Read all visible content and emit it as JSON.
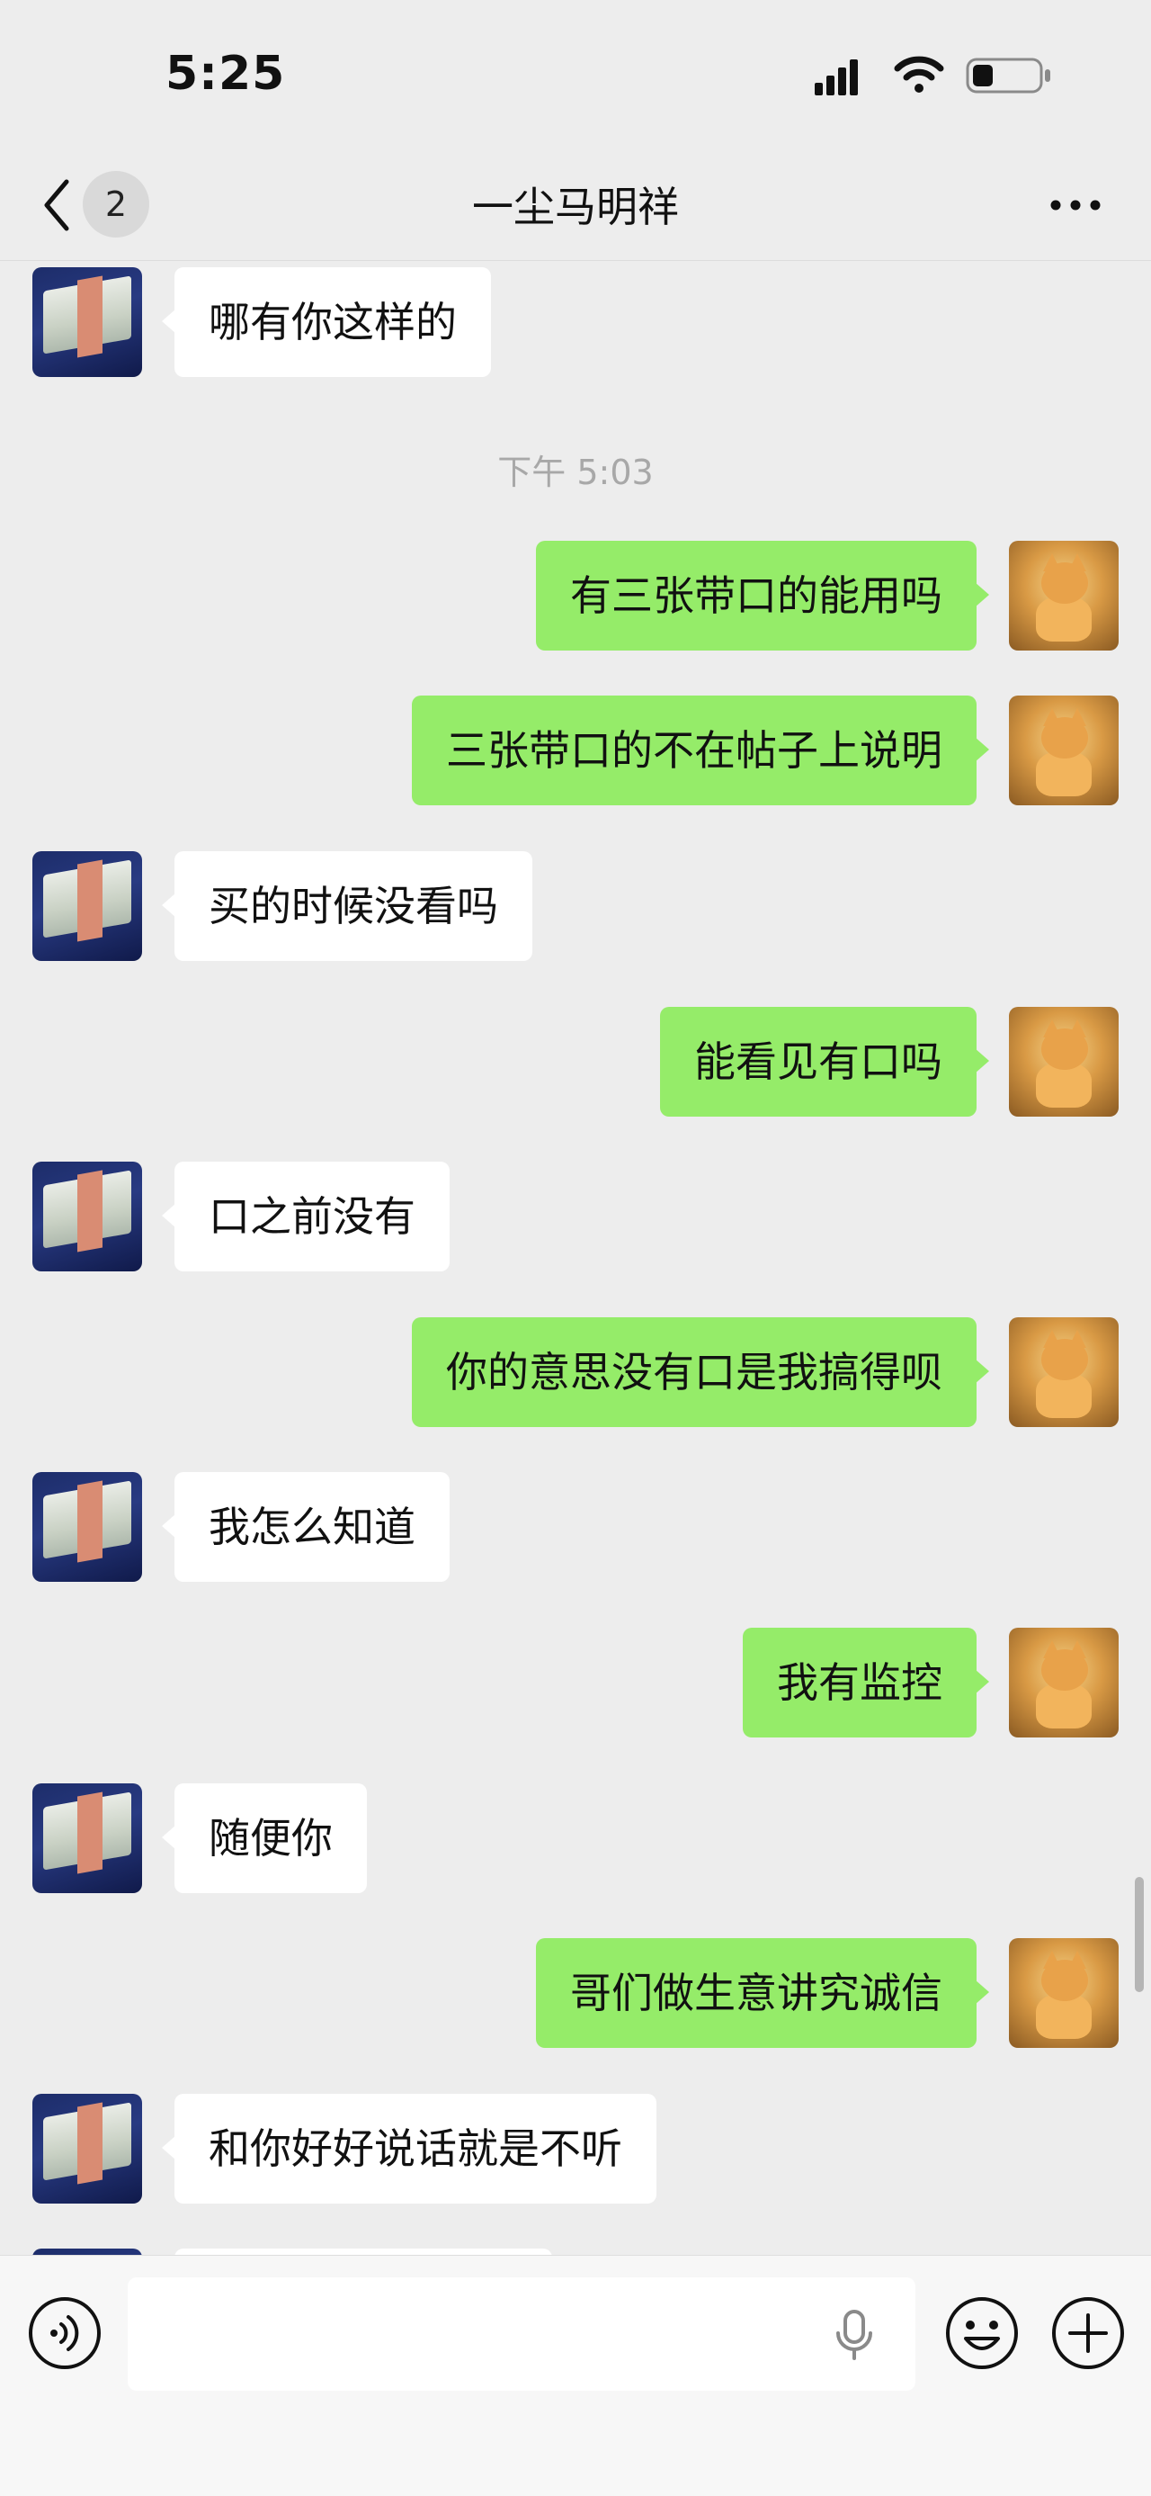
{
  "status_bar": {
    "time": "5:25"
  },
  "nav": {
    "unread_count": "2",
    "title": "一尘马明祥"
  },
  "chat": {
    "timestamp": "下午 5:03",
    "messages": [
      {
        "side": "in",
        "text": "哪有你这样的"
      },
      {
        "side": "out",
        "text": "有三张带口的能用吗"
      },
      {
        "side": "out",
        "text": "三张带口的不在帖子上说明"
      },
      {
        "side": "in",
        "text": "买的时候没看吗"
      },
      {
        "side": "out",
        "text": "能看见有口吗"
      },
      {
        "side": "in",
        "text": "口之前没有"
      },
      {
        "side": "out",
        "text": "你的意思没有口是我搞得呗"
      },
      {
        "side": "in",
        "text": "我怎么知道"
      },
      {
        "side": "out",
        "text": "我有监控"
      },
      {
        "side": "in",
        "text": "随便你"
      },
      {
        "side": "out",
        "text": "哥们做生意讲究诚信"
      },
      {
        "side": "in",
        "text": "和你好好说话就是不听"
      }
    ]
  },
  "input_bar": {
    "value": "",
    "placeholder": ""
  },
  "colors": {
    "incoming_bubble": "#ffffff",
    "outgoing_bubble": "#95ec69",
    "background": "#ededed"
  },
  "icons": [
    "signal-icon",
    "wifi-icon",
    "battery-icon",
    "back-icon",
    "more-icon",
    "voice-icon",
    "mic-icon",
    "emoji-icon",
    "plus-icon"
  ]
}
